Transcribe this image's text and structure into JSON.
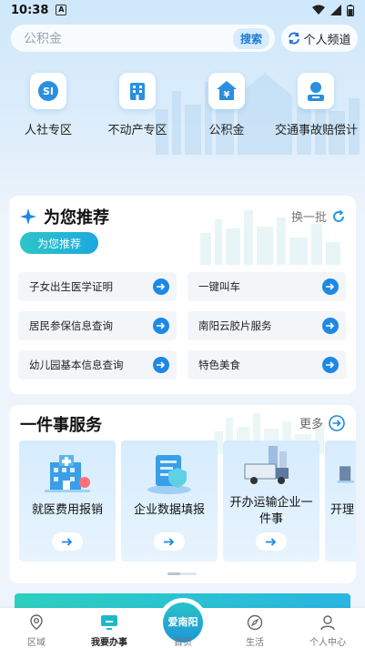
{
  "status_bar": {
    "time": "10:38",
    "notification_letter": "A"
  },
  "search": {
    "placeholder": "公积金",
    "button": "搜索"
  },
  "personal_channel": {
    "label": "个人频道"
  },
  "quick_entries": [
    {
      "label": "人社专区",
      "icon": "social-security-icon"
    },
    {
      "label": "不动产专区",
      "icon": "building-icon"
    },
    {
      "label": "公积金",
      "icon": "yen-house-icon"
    },
    {
      "label": "交通事故赔偿计",
      "icon": "person-badge-icon"
    }
  ],
  "recommend": {
    "title": "为您推荐",
    "refresh": "换一批",
    "tag": "为您推荐",
    "items": [
      "子女出生医学证明",
      "一键叫车",
      "居民参保信息查询",
      "南阳云胶片服务",
      "幼儿园基本信息查询",
      "特色美食"
    ]
  },
  "services": {
    "title": "一件事服务",
    "more": "更多",
    "cards": [
      {
        "label": "就医费用报销",
        "icon": "hospital-icon"
      },
      {
        "label": "企业数据填报",
        "icon": "document-shield-icon"
      },
      {
        "label": "开办运输企业一件事",
        "icon": "truck-icon"
      },
      {
        "label": "开理",
        "icon": "service-icon"
      }
    ]
  },
  "tabbar": {
    "items": [
      {
        "label": "区域",
        "icon": "location-icon"
      },
      {
        "label": "我要办事",
        "icon": "monitor-icon"
      },
      {
        "label": "首页",
        "icon": "home-icon"
      },
      {
        "label": "生活",
        "icon": "compass-icon"
      },
      {
        "label": "个人中心",
        "icon": "user-icon"
      }
    ],
    "center_text_1": "爱南阳",
    "center_text_2": "首页"
  },
  "colors": {
    "accent": "#1e88e5",
    "teal": "#2cc6c6",
    "bg": "#eef4fb"
  }
}
